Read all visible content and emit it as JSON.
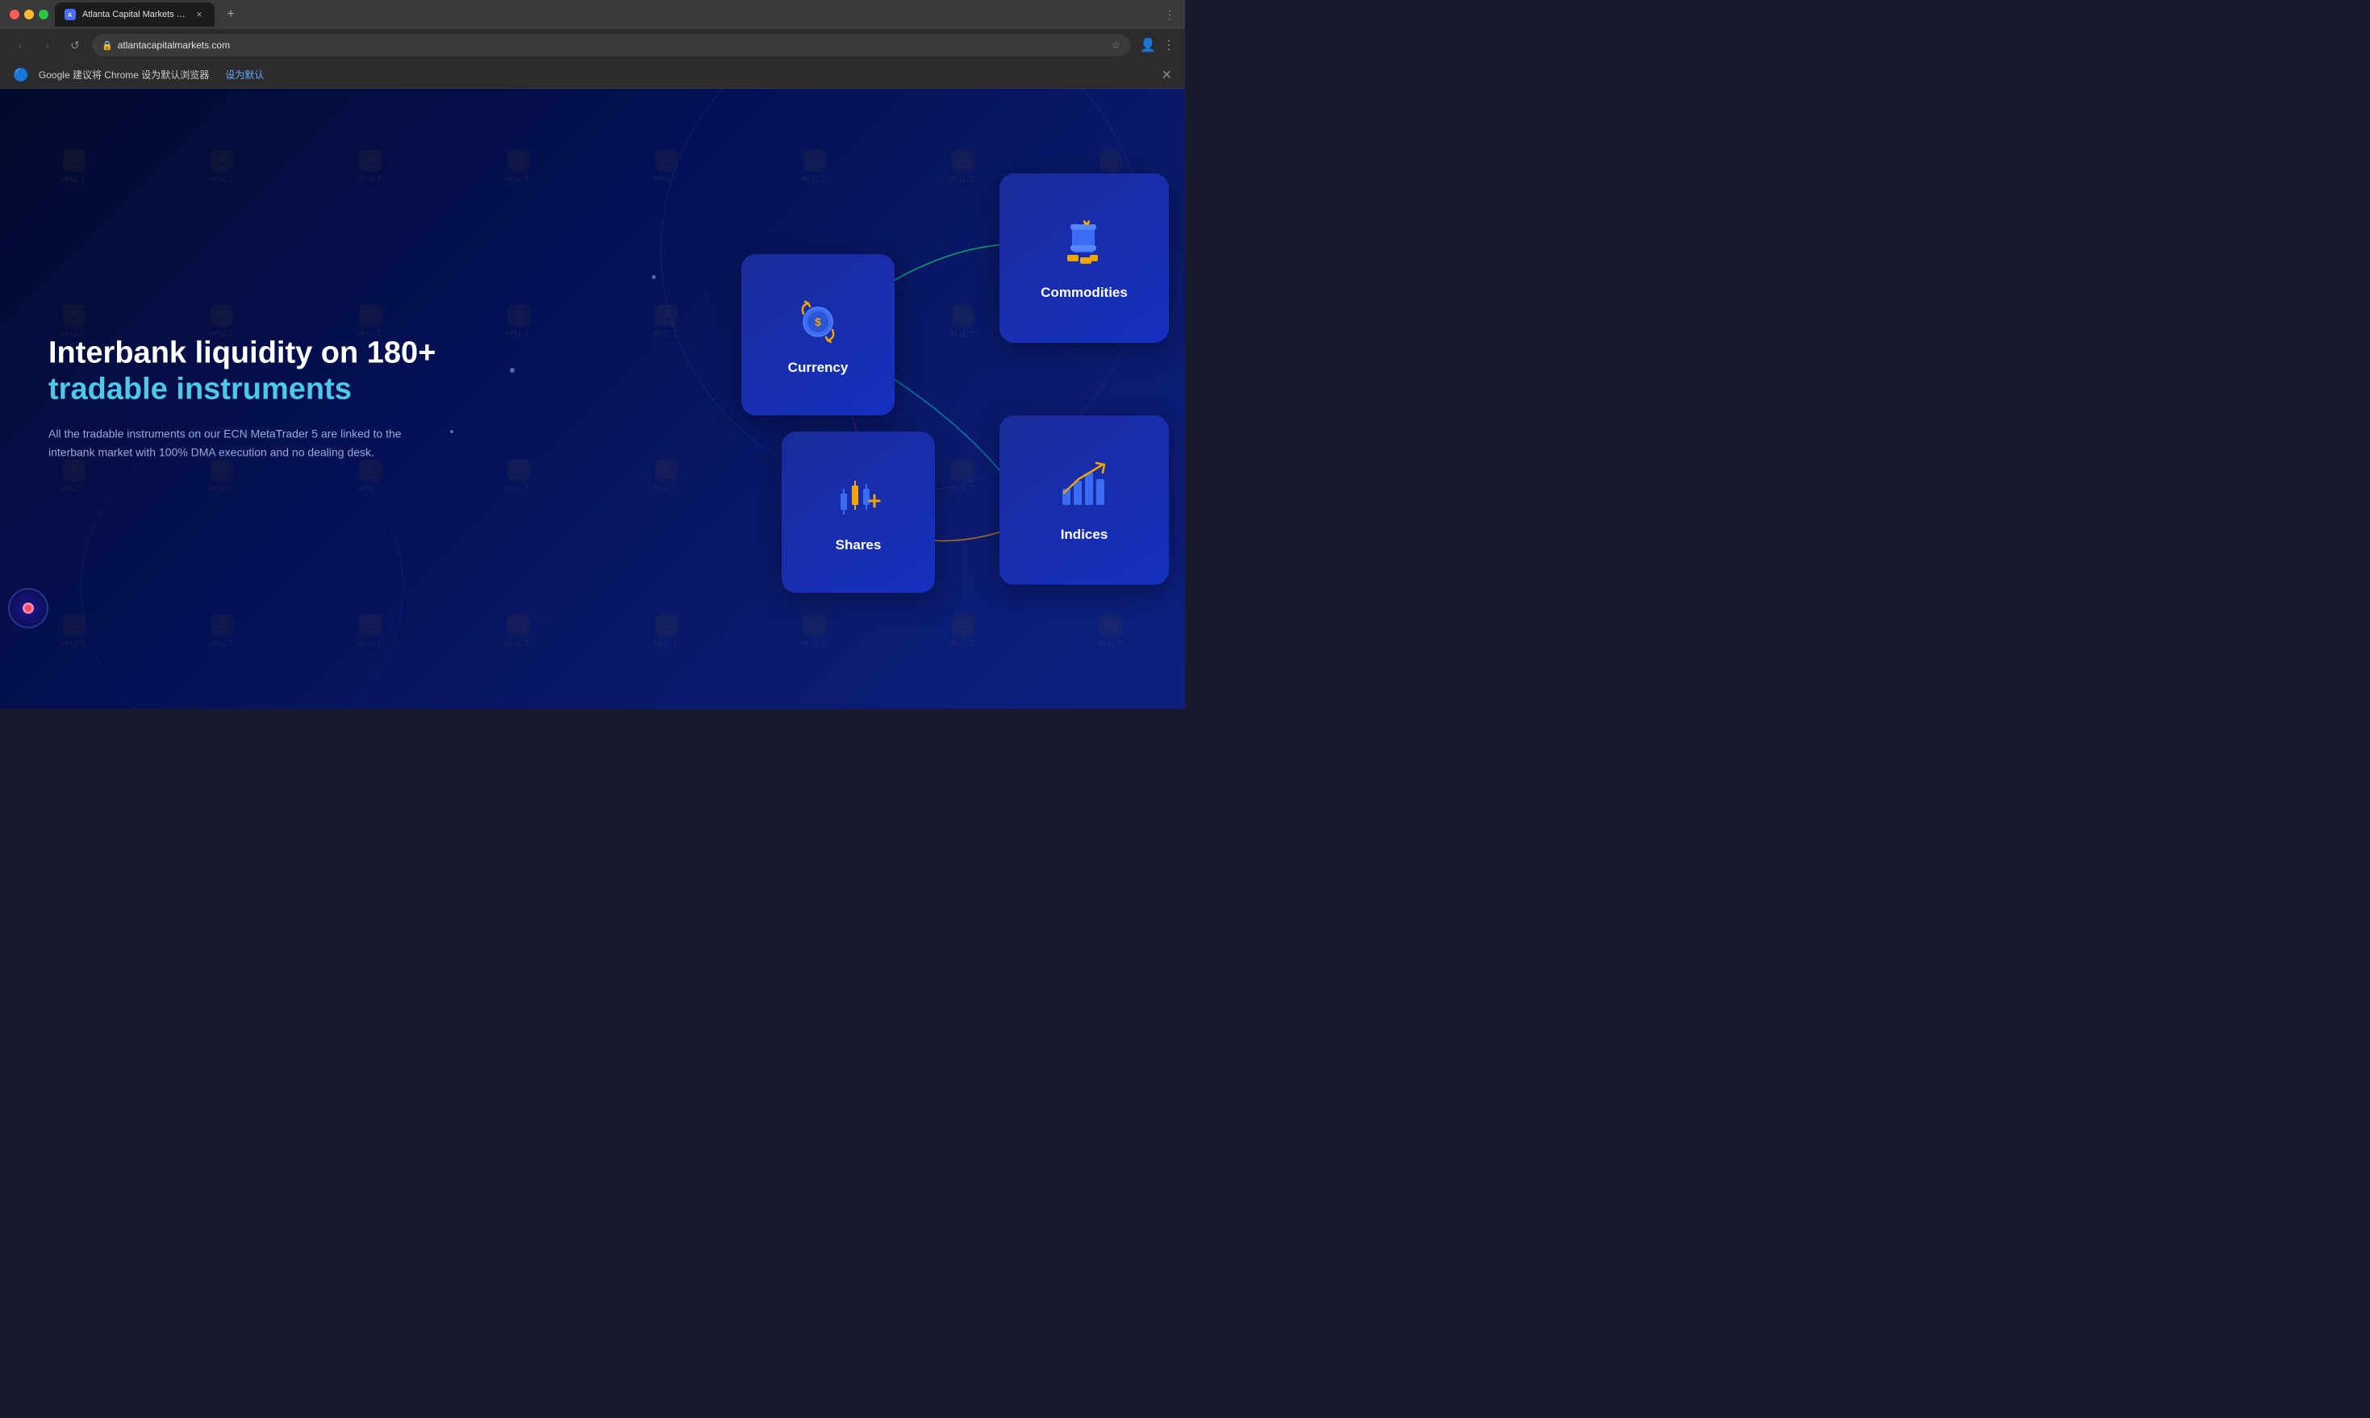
{
  "browser": {
    "tab_title": "Atlanta Capital Markets - Atla...",
    "tab_favicon": "A",
    "new_tab_label": "+",
    "nav": {
      "back": "‹",
      "forward": "›",
      "refresh": "↺",
      "url": "atlantacapitalmarkets.com"
    },
    "notification": {
      "text": "Google 建议将 Chrome 设为默认浏览器",
      "action_label": "设为默认",
      "close_label": "✕"
    }
  },
  "page": {
    "headline_line1": "Interbank liquidity on 180+",
    "headline_line2": "tradable instruments",
    "description": "All the tradable instruments on our ECN MetaTrader 5 are linked to the interbank market with 100% DMA execution and no dealing desk.",
    "cards": [
      {
        "id": "currency",
        "label": "Currency"
      },
      {
        "id": "commodities",
        "label": "Commodities"
      },
      {
        "id": "shares",
        "label": "Shares"
      },
      {
        "id": "indices",
        "label": "Indices"
      }
    ]
  },
  "colors": {
    "accent_cyan": "#4dc8e8",
    "card_blue": "#1530c0",
    "orange": "#f0a500",
    "background_deep": "#020b2d"
  }
}
